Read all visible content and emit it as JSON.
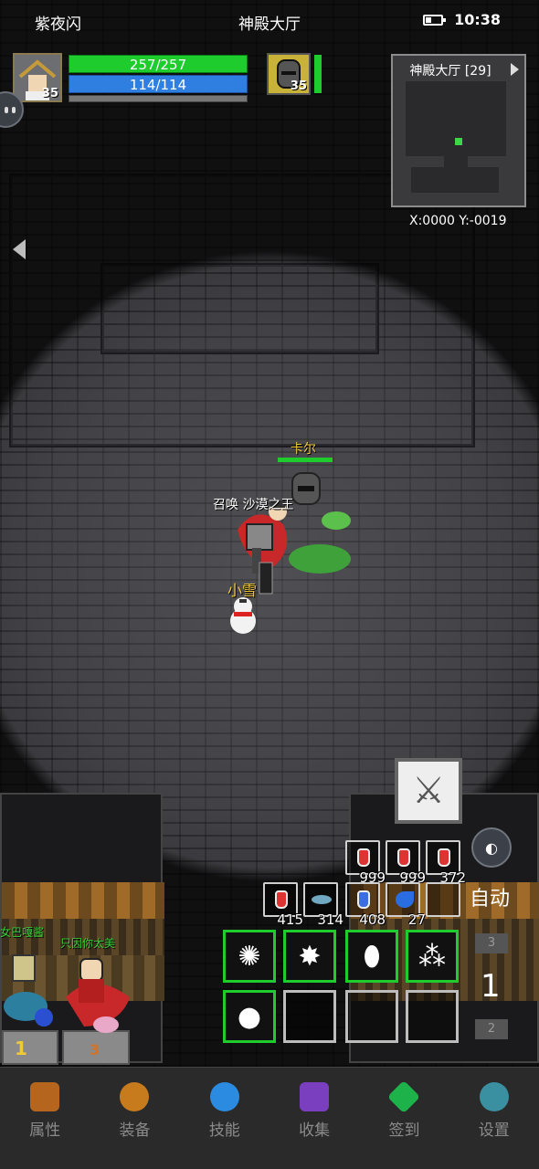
{
  "status_bar": {
    "player_name": "紫夜闪",
    "location": "神殿大厅",
    "time": "10:38"
  },
  "player": {
    "level": "35",
    "hp": "257/257",
    "mp": "114/114"
  },
  "pet": {
    "level": "35"
  },
  "minimap": {
    "title": "神殿大厅 [29]",
    "coordinates": "X:0000  Y:-0019"
  },
  "characters": {
    "pet_name": "卡尔",
    "summon_label": "召唤 沙漠之王",
    "companion_name": "小雪",
    "other_player_1": "女巴嘎酱",
    "other_player_2": "只因你太美"
  },
  "potions_row1": [
    {
      "icon": "red-potion-icon",
      "count": "999"
    },
    {
      "icon": "red-potion-icon",
      "count": "999"
    },
    {
      "icon": "red-potion-icon",
      "count": "372"
    }
  ],
  "potions_row2": [
    {
      "icon": "red-potion-icon",
      "count": "415"
    },
    {
      "icon": "fish-icon",
      "count": "314"
    },
    {
      "icon": "blue-potion-icon",
      "count": "408"
    },
    {
      "icon": "feather-icon",
      "count": "27"
    }
  ],
  "controls": {
    "auto_label": "自动",
    "skill_page": "1",
    "page_up": "3",
    "page_down": "2"
  },
  "nav": [
    {
      "label": "属性",
      "icon": "helmet-icon",
      "color": "#b5651d"
    },
    {
      "label": "装备",
      "icon": "bag-icon",
      "color": "#c77b1d"
    },
    {
      "label": "技能",
      "icon": "skill-orb-icon",
      "color": "#2a8be0"
    },
    {
      "label": "收集",
      "icon": "collection-icon",
      "color": "#7a3fbf"
    },
    {
      "label": "签到",
      "icon": "gem-icon",
      "color": "#1eb34a"
    },
    {
      "label": "设置",
      "icon": "gear-icon",
      "color": "#3a8fa0"
    }
  ],
  "colors": {
    "hp_bar": "#1ecc2e",
    "mp_bar": "#2f7fe0",
    "skill_border": "#1ecc2e",
    "pet_name": "#f0c93a",
    "other_player_1": "#36d236",
    "other_player_2": "#36d236"
  }
}
